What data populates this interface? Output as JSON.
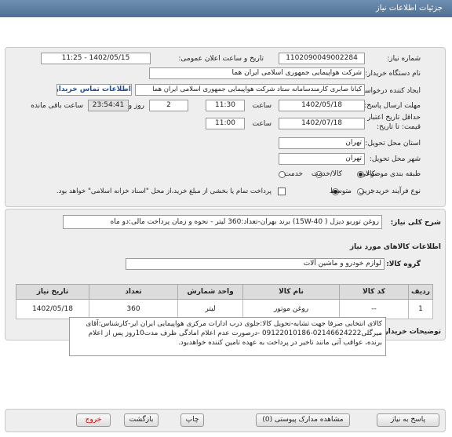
{
  "header": {
    "title": "جزئیات اطلاعات نیاز"
  },
  "form": {
    "need_number_label": "شماره نیاز:",
    "need_number": "1102090049002284",
    "announce_label": "تاریخ و ساعت اعلان عمومی:",
    "announce_value": "1402/05/15 - 11:25",
    "buyer_org_label": "نام دستگاه خریدار:",
    "buyer_org": "شرکت هواپیمایی جمهوری اسلامی ایران هما",
    "creator_label": "ایجاد کننده درخواست:",
    "creator": "کیانا صابری کارمندسامانه ستاد شرکت هواپیمایی جمهوری اسلامی ایران هما",
    "contact_button": "اطلاعات تماس خریدار",
    "deadline_label": "مهلت ارسال پاسخ: تا تاریخ:",
    "deadline_date": "1402/05/18",
    "time_label": "ساعت",
    "deadline_time": "11:30",
    "days": "2",
    "days_label": "روز و",
    "remaining": "23:54:41",
    "remaining_label": "ساعت باقی مانده",
    "validity_label_1": "حداقل تاریخ اعتبار",
    "validity_label_2": "قیمت: تا تاریخ:",
    "validity_date": "1402/07/18",
    "validity_time_label": "ساعت",
    "validity_time": "11:00",
    "province_label": "استان محل تحویل:",
    "province": "تهران",
    "city_label": "شهر محل تحویل:",
    "city": "تهران",
    "category_label": "طبقه بندی موضوعی:",
    "category_options": [
      "کالا",
      "کالا/خدمت",
      "خدمت"
    ],
    "process_label": "نوع فرآیند خرید :",
    "process_options": [
      "جزیی",
      "متوسط"
    ],
    "treasury_note": "پرداخت تمام یا بخشی از مبلغ خرید،از محل \"اسناد خزانه اسلامی\" خواهد بود."
  },
  "summary": {
    "label": "شرح کلی نیاز:",
    "text": "روغن توربو دیزل ( 15W-40) برند بهران-تعداد:360 لیتر - نحوه و زمان پرداخت مالی:دو ماه"
  },
  "goods": {
    "section_title": "اطلاعات کالاهای مورد نیاز",
    "group_label": "گروه کالا:",
    "group_value": "لوازم خودرو و ماشین آلات",
    "columns": [
      "ردیف",
      "کد کالا",
      "نام کالا",
      "واحد شمارش",
      "تعداد",
      "تاریخ نیاز"
    ],
    "rows": [
      {
        "index": "1",
        "code": "--",
        "name": "روغن موتور",
        "unit": "لیتر",
        "qty": "360",
        "date": "1402/05/18"
      }
    ]
  },
  "buyer_notes": {
    "label": "توضیحات خریدار:",
    "text": "کالای انتخابی صرفا جهت تشابه-تحویل کالا:جلوی درب ادارات مرکزی هواپیمایی ایران ایر-کارشناس:آقای میرگلی02146624222-09122010186 -درصورت عدم اعلام امادگی ظرف مدت10روز پس از اعلام برنده، عواقب آتی مانند تاخیر در پرداخت به عهده تامین کننده خواهدبود."
  },
  "actions": {
    "reply": "پاسخ به نیاز",
    "view_docs": "مشاهده مدارک پیوستی (0)",
    "print": "چاپ",
    "back": "بازگشت",
    "exit": "خروج"
  },
  "watermark": {
    "brand": "ParsNamadData",
    "subtitle": "پایگاه اطلاع رسانی مناقصات و مزایدات",
    "phone": "۰۲۱-۸۸۳۴۹۶۷۰-۵"
  }
}
